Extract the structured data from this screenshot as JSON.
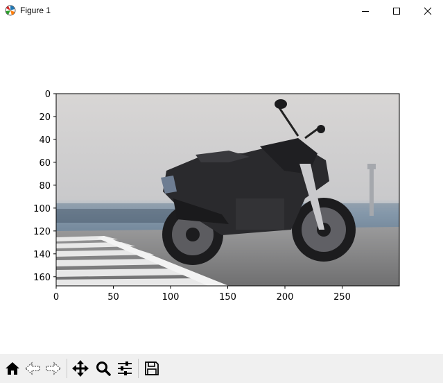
{
  "window": {
    "title": "Figure 1",
    "minimize_icon": "minimize-icon",
    "maximize_icon": "maximize-icon",
    "close_icon": "close-icon"
  },
  "figure": {
    "image_description_icon": "image-icon",
    "x_ticks": [
      "0",
      "50",
      "100",
      "150",
      "200",
      "250"
    ],
    "y_ticks": [
      "0",
      "20",
      "40",
      "60",
      "80",
      "100",
      "120",
      "140",
      "160"
    ]
  },
  "chart_data": {
    "type": "image",
    "xlim": [
      0,
      300
    ],
    "ylim": [
      168,
      0
    ],
    "x_ticks": [
      0,
      50,
      100,
      150,
      200,
      250
    ],
    "y_ticks": [
      0,
      20,
      40,
      60,
      80,
      100,
      120,
      140,
      160
    ]
  },
  "toolbar": {
    "buttons": [
      {
        "icon": "home-icon"
      },
      {
        "icon": "back-arrow-icon"
      },
      {
        "icon": "forward-arrow-icon"
      },
      {
        "icon": "pan-icon"
      },
      {
        "icon": "zoom-icon"
      },
      {
        "icon": "subplots-config-icon"
      },
      {
        "icon": "save-icon"
      }
    ]
  }
}
